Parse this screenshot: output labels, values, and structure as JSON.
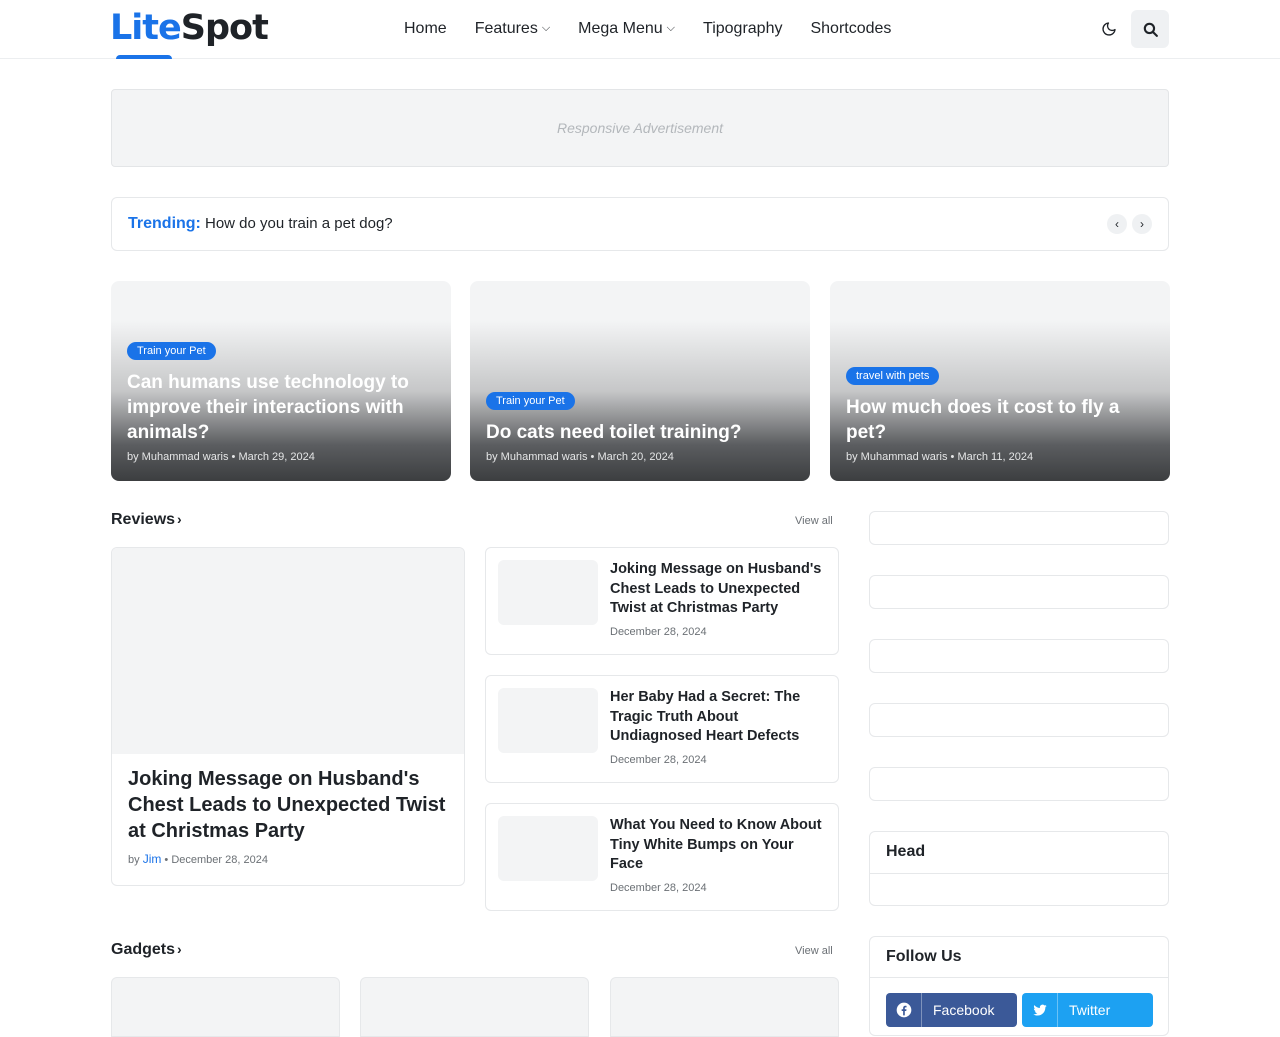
{
  "header": {
    "logo_lite": "Lite",
    "logo_spot": "Spot",
    "nav": [
      {
        "label": "Home"
      },
      {
        "label": "Features"
      },
      {
        "label": "Mega Menu"
      },
      {
        "label": "Tipography"
      },
      {
        "label": "Shortcodes"
      }
    ],
    "icons": [
      "moon-icon",
      "search-icon"
    ]
  },
  "ad": {
    "text": "Responsive Advertisement"
  },
  "trending": {
    "label": "Trending:",
    "text": "How do you train a pet dog?",
    "prev": "‹",
    "next": "›"
  },
  "featured": [
    {
      "tag": "Train your Pet",
      "title": "Can humans use technology to improve their interactions with animals?",
      "meta": "by Muhammad waris • March 29, 2024"
    },
    {
      "tag": "Train your Pet",
      "title": "Do cats need toilet training?",
      "meta": "by Muhammad waris • March 20, 2024"
    },
    {
      "tag": "travel with pets",
      "title": "How much does it cost to fly a pet?",
      "meta": "by Muhammad waris • March 11, 2024"
    }
  ],
  "reviews": {
    "title": "Reviews",
    "view_all": "View all",
    "main": {
      "title": "Joking Message on Husband's Chest Leads to Unexpected Twist at Christmas Party",
      "by": "by",
      "author": "Jim",
      "date": "• December 28, 2024"
    },
    "items": [
      {
        "title": "Joking Message on Husband's Chest Leads to Unexpected Twist at Christmas Party",
        "date": "December 28, 2024"
      },
      {
        "title": "Her Baby Had a Secret: The Tragic Truth About Undiagnosed Heart Defects",
        "date": "December 28, 2024"
      },
      {
        "title": "What You Need to Know About Tiny White Bumps on Your Face",
        "date": "December 28, 2024"
      }
    ]
  },
  "gadgets": {
    "title": "Gadgets",
    "view_all": "View all"
  },
  "sidebar": {
    "head_title": "Head",
    "follow_title": "Follow Us",
    "social": [
      {
        "label": "Facebook",
        "color": "#3b5998"
      },
      {
        "label": "Twitter",
        "color": "#1da1f2"
      }
    ]
  },
  "colors": {
    "accent": "#1a73e8",
    "text": "#1f2328",
    "muted": "#6b7075",
    "placeholder": "#f3f4f5"
  }
}
